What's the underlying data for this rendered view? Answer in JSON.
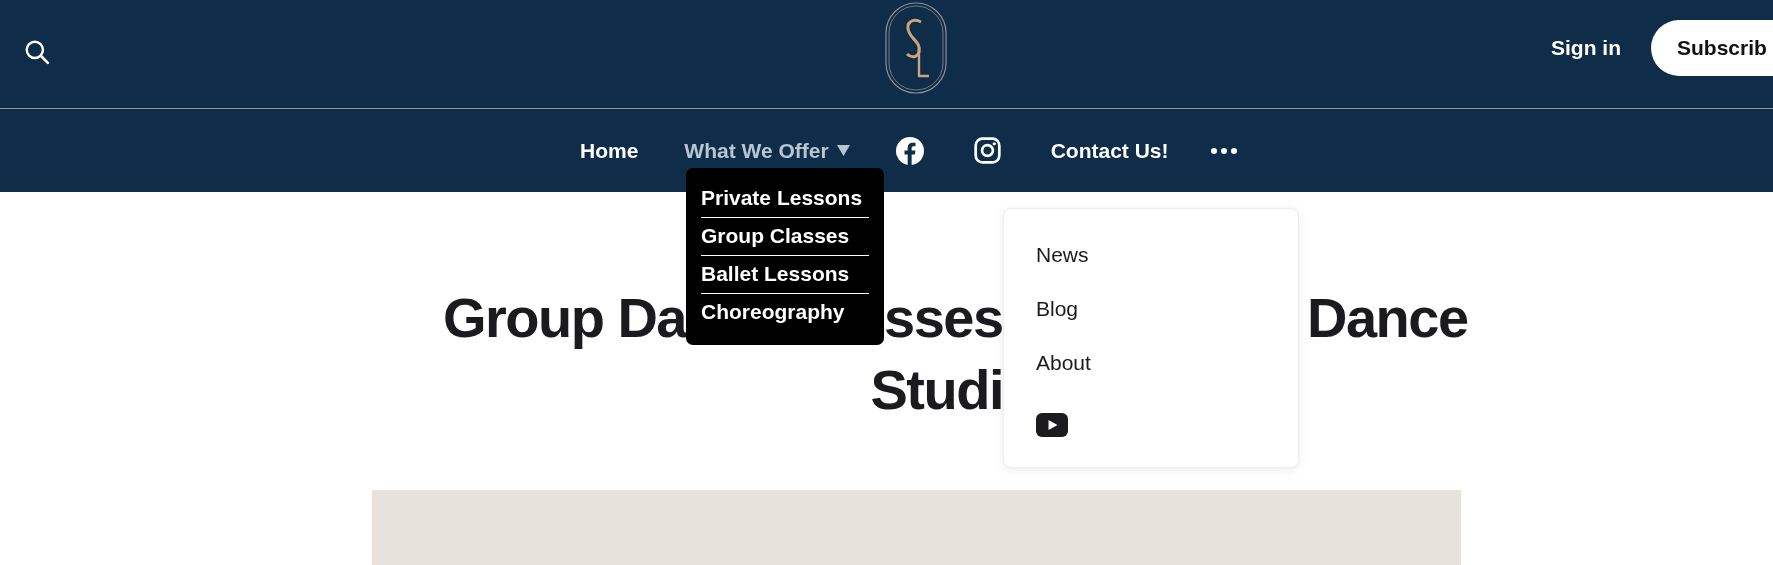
{
  "header": {
    "sign_in": "Sign in",
    "subscribe": "Subscrib"
  },
  "nav": {
    "links": [
      {
        "label": "Home",
        "expanded": false
      },
      {
        "label": "What We Offer",
        "expanded": true,
        "children": [
          {
            "label": "Private Lessons"
          },
          {
            "label": "Group Classes"
          },
          {
            "label": "Ballet Lessons"
          },
          {
            "label": "Choreography"
          }
        ]
      }
    ],
    "after_icons": [
      {
        "label": "Contact Us!"
      }
    ],
    "more_menu": {
      "open": true,
      "items": [
        {
          "label": "News"
        },
        {
          "label": "Blog"
        },
        {
          "label": "About"
        }
      ]
    }
  },
  "title": {
    "line_1": [
      "Group Da",
      "sses",
      "Dance"
    ],
    "line_2": "Studi"
  }
}
